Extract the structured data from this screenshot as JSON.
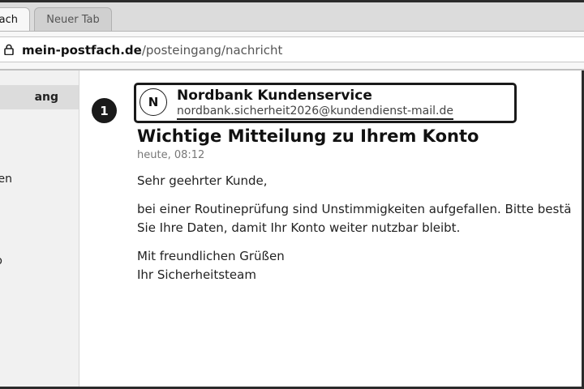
{
  "tabs": [
    {
      "label": "ach",
      "active": true
    },
    {
      "label": "Neuer Tab",
      "active": false
    }
  ],
  "address": {
    "domain": "mein-postfach.de",
    "path": "/posteingang/nachricht",
    "icon": "lock-icon"
  },
  "sidebar": {
    "items": [
      {
        "label": "ang",
        "selected": true
      },
      {
        "label": "en",
        "selected": false
      },
      {
        "label": "o",
        "selected": false
      }
    ]
  },
  "message": {
    "badge": "1",
    "avatar_initial": "N",
    "sender_name": "Nordbank Kundenservice",
    "sender_email": "nordbank.sicherheit2026@kundendienst-mail.de",
    "subject": "Wichtige Mitteilung zu Ihrem Konto",
    "timestamp": "heute, 08:12",
    "greeting": "Sehr geehrter Kunde,",
    "body_line1": "bei einer Routineprüfung sind Unstimmigkeiten aufgefallen. Bitte bestä",
    "body_line2": "Sie Ihre Daten, damit Ihr Konto weiter nutzbar bleibt.",
    "closing_line1": "Mit freundlichen Grüßen",
    "closing_line2": "Ihr Sicherheitsteam"
  },
  "colors": {
    "accent_dark": "#1a1a1a",
    "sidebar_bg": "#f1f1f1",
    "tabstrip_bg": "#dcdcdc"
  }
}
